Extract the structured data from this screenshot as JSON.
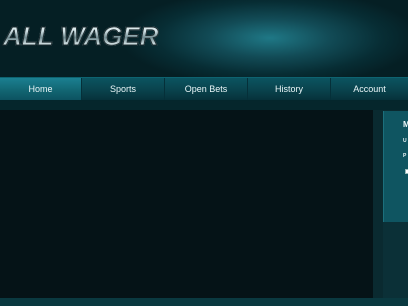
{
  "brand": {
    "logo_text": "ALL WAGER"
  },
  "nav": {
    "items": [
      {
        "label": "Home",
        "active": true
      },
      {
        "label": "Sports",
        "active": false
      },
      {
        "label": "Open Bets",
        "active": false
      },
      {
        "label": "History",
        "active": false
      },
      {
        "label": "Account",
        "active": false
      }
    ]
  },
  "login": {
    "title": "M",
    "username_label": "U",
    "password_label": "P"
  },
  "colors": {
    "accent": "#126673",
    "background": "#051317",
    "nav": "#09414b"
  }
}
